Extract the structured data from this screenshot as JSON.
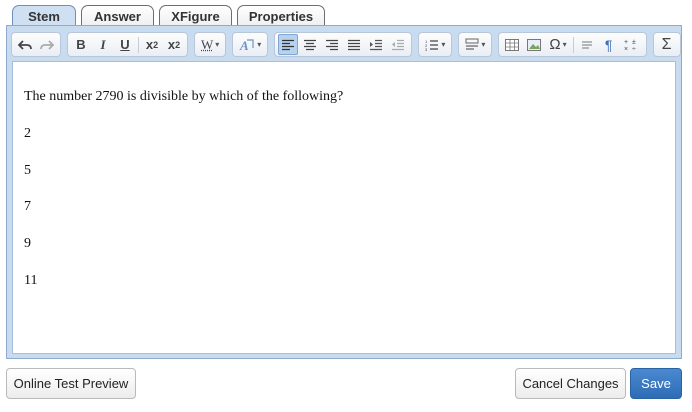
{
  "tabs": [
    {
      "label": "Stem",
      "active": true
    },
    {
      "label": "Answer",
      "active": false
    },
    {
      "label": "XFigure",
      "active": false
    },
    {
      "label": "Properties",
      "active": false
    }
  ],
  "toolbar": {
    "bold": "B",
    "italic": "I",
    "underline": "U",
    "subscript": "x",
    "subscript_mark": "2",
    "superscript": "x",
    "superscript_mark": "2",
    "font": "W",
    "sigma": "Σ",
    "omega": "Ω",
    "paragraph": "¶",
    "icons": [
      "undo-icon",
      "redo-icon",
      "text-color-icon",
      "align-left-icon",
      "align-center-icon",
      "align-right-icon",
      "justify-icon",
      "indent-icon",
      "outdent-icon",
      "numbered-list-icon",
      "format-icon",
      "table-icon",
      "image-icon",
      "special-char-icon",
      "format-align-icon",
      "paragraph-icon",
      "fraction-icon",
      "sigma-icon"
    ]
  },
  "content": {
    "question": "The number 2790 is divisible by which of the following?",
    "options": [
      "2",
      "5",
      "7",
      "9",
      "11"
    ]
  },
  "footer": {
    "preview_label": "Online Test Preview",
    "cancel_label": "Cancel Changes",
    "save_label": "Save"
  },
  "colors": {
    "accent": "#2e6db5",
    "editor_bg": "#c9dbef",
    "active_tab": "#cfe0f3"
  }
}
